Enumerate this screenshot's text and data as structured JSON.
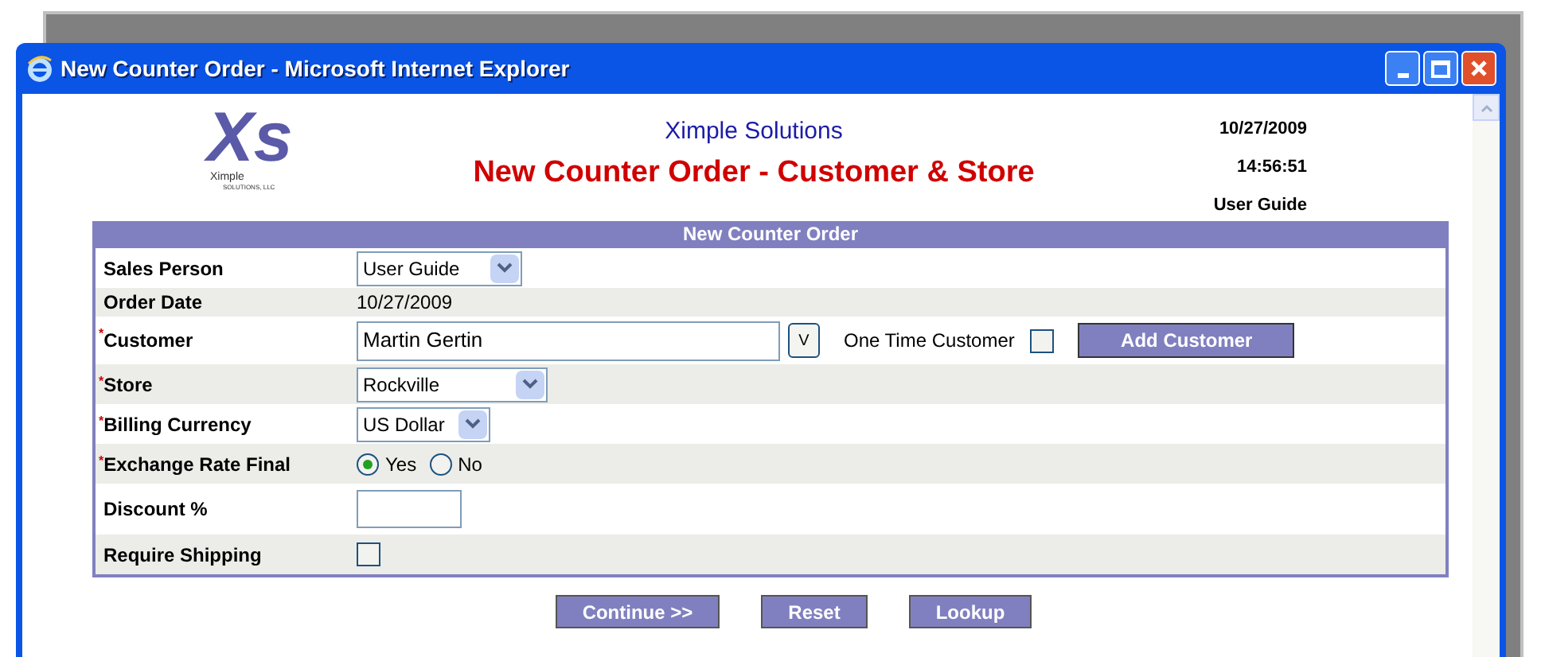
{
  "window": {
    "title": "New Counter Order - Microsoft Internet Explorer"
  },
  "header": {
    "company": "Ximple Solutions",
    "title": "New Counter Order - Customer & Store",
    "date": "10/27/2009",
    "time": "14:56:51",
    "user": "User Guide",
    "logo_letters": "Xs",
    "logo_caption": "Ximple",
    "logo_subcaption": "SOLUTIONS, LLC"
  },
  "form": {
    "title": "New Counter Order",
    "rows": [
      {
        "kind": "select",
        "label": "Sales Person",
        "value": "User Guide"
      },
      {
        "kind": "text",
        "label": "Order Date",
        "value": "10/27/2009"
      },
      {
        "kind": "customer",
        "label": "Customer",
        "required_mark": "*",
        "value": "Martin Gertin",
        "lookup_label": "V",
        "one_time_label": "One Time Customer",
        "one_time_checked": false,
        "add_label": "Add Customer"
      },
      {
        "kind": "select",
        "label": "Store",
        "required_mark": "*",
        "value": "Rockville"
      },
      {
        "kind": "select",
        "label": "Billing Currency",
        "required_mark": "*",
        "value": "US Dollar"
      },
      {
        "kind": "radio",
        "label": "Exchange Rate Final",
        "required_mark": "*",
        "options": [
          {
            "label": "Yes",
            "selected": true
          },
          {
            "label": "No",
            "selected": false
          }
        ]
      },
      {
        "kind": "input",
        "label": "Discount %",
        "value": ""
      },
      {
        "kind": "checkbox",
        "label": "Require Shipping",
        "checked": false
      }
    ]
  },
  "buttons": [
    "Continue >>",
    "Reset",
    "Lookup"
  ]
}
